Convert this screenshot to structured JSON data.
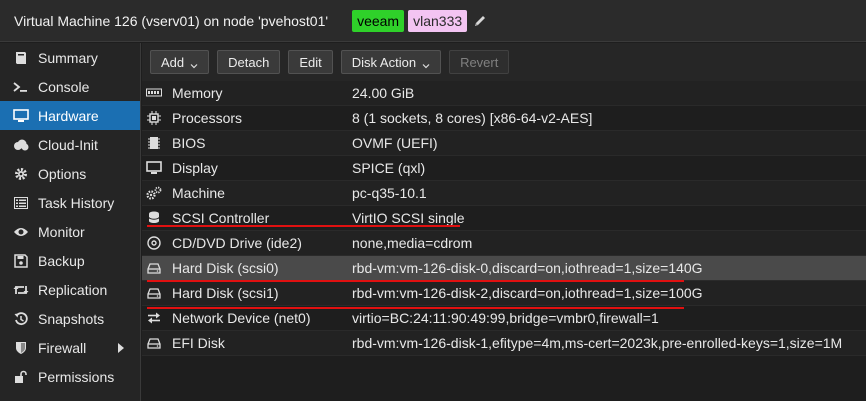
{
  "window": {
    "title": "Virtual Machine 126 (vserv01) on node 'pvehost01'",
    "tags": [
      {
        "label": "veeam",
        "color": "#2fd12a"
      },
      {
        "label": "vlan333",
        "color": "#f3c4f2"
      }
    ],
    "edit_icon": "pencil-icon"
  },
  "sidebar": {
    "items": [
      {
        "label": "Summary",
        "icon": "book-icon"
      },
      {
        "label": "Console",
        "icon": "terminal-icon"
      },
      {
        "label": "Hardware",
        "icon": "monitor-icon",
        "active": true
      },
      {
        "label": "Cloud-Init",
        "icon": "cloud-icon"
      },
      {
        "label": "Options",
        "icon": "gear-icon"
      },
      {
        "label": "Task History",
        "icon": "list-icon"
      },
      {
        "label": "Monitor",
        "icon": "eye-icon"
      },
      {
        "label": "Backup",
        "icon": "floppy-icon"
      },
      {
        "label": "Replication",
        "icon": "retweet-icon"
      },
      {
        "label": "Snapshots",
        "icon": "history-icon"
      },
      {
        "label": "Firewall",
        "icon": "shield-icon"
      },
      {
        "label": "Permissions",
        "icon": "unlock-icon"
      }
    ]
  },
  "toolbar": {
    "add_label": "Add",
    "detach_label": "Detach",
    "edit_label": "Edit",
    "disk_action_label": "Disk Action",
    "revert_label": "Revert"
  },
  "hardware": {
    "rows": [
      {
        "name": "Memory",
        "value": "24.00 GiB",
        "icon": "memory-icon"
      },
      {
        "name": "Processors",
        "value": "8 (1 sockets, 8 cores) [x86-64-v2-AES]",
        "icon": "cpu-icon"
      },
      {
        "name": "BIOS",
        "value": "OVMF (UEFI)",
        "icon": "chip-icon"
      },
      {
        "name": "Display",
        "value": "SPICE (qxl)",
        "icon": "desktop-icon"
      },
      {
        "name": "Machine",
        "value": "pc-q35-10.1",
        "icon": "cogs-icon"
      },
      {
        "name": "SCSI Controller",
        "value": "VirtIO SCSI single",
        "icon": "database-icon"
      },
      {
        "name": "CD/DVD Drive (ide2)",
        "value": "none,media=cdrom",
        "icon": "disc-icon"
      },
      {
        "name": "Hard Disk (scsi0)",
        "value": "rbd-vm:vm-126-disk-0,discard=on,iothread=1,size=140G",
        "icon": "hdd-icon",
        "selected": true
      },
      {
        "name": "Hard Disk (scsi1)",
        "value": "rbd-vm:vm-126-disk-2,discard=on,iothread=1,size=100G",
        "icon": "hdd-icon"
      },
      {
        "name": "Network Device (net0)",
        "value": "virtio=BC:24:11:90:49:99,bridge=vmbr0,firewall=1",
        "icon": "exchange-icon"
      },
      {
        "name": "EFI Disk",
        "value": "rbd-vm:vm-126-disk-1,efitype=4m,ms-cert=2023k,pre-enrolled-keys=1,size=1M",
        "icon": "hdd-icon"
      }
    ]
  },
  "annotation": {
    "color": "#e01010"
  }
}
